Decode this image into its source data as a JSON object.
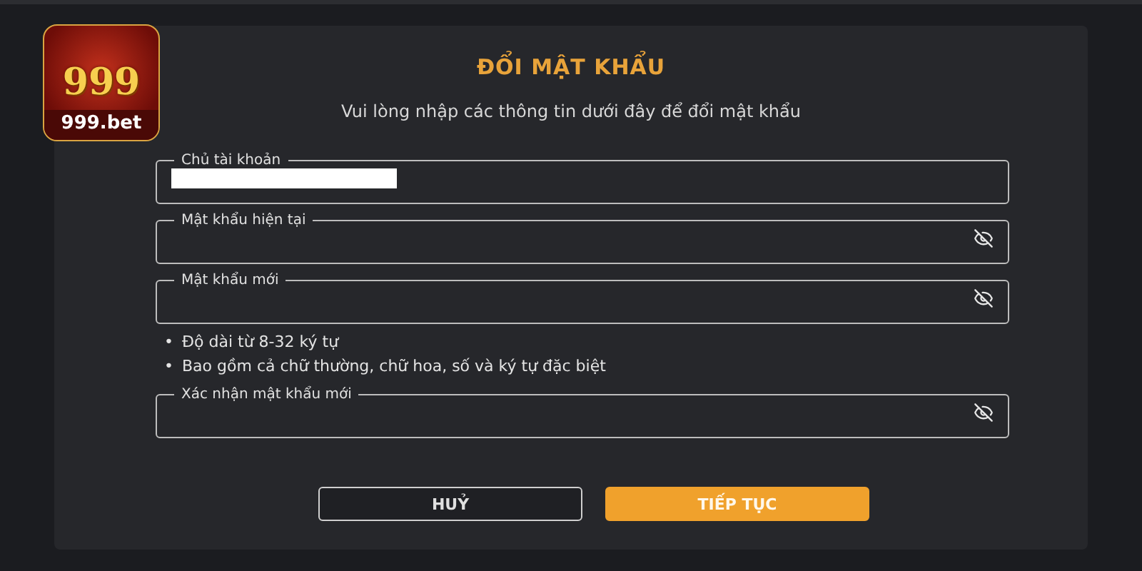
{
  "logo": {
    "number": "999",
    "caption": "999.bet"
  },
  "title": "ĐỔI MẬT KHẨU",
  "subtitle": "Vui lòng nhập các thông tin dưới đây để đổi mật khẩu",
  "fields": [
    {
      "label": "Chủ tài khoản",
      "kind": "redacted"
    },
    {
      "label": "Mật khẩu hiện tại",
      "kind": "password"
    },
    {
      "label": "Mật khẩu mới",
      "kind": "password",
      "hint_marker": "•",
      "hints": [
        "Độ dài từ 8-32 ký tự",
        "Bao gồm cả chữ thường, chữ hoa, số và ký tự đặc biệt"
      ]
    },
    {
      "label": "Xác nhận mật khẩu mới",
      "kind": "password"
    }
  ],
  "buttons": [
    {
      "label": "HUỶ",
      "kind": "secondary"
    },
    {
      "label": "TIẾP TỤC",
      "kind": "primary"
    }
  ]
}
